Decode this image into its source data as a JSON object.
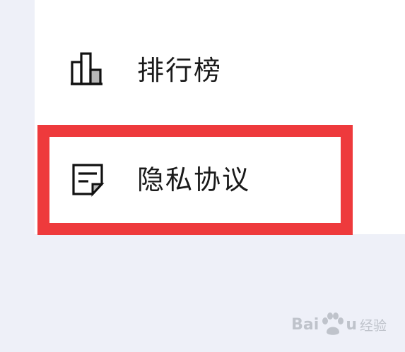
{
  "menu": {
    "items": [
      {
        "label": "排行榜",
        "icon": "bar-chart-icon"
      },
      {
        "label": "隐私协议",
        "icon": "document-note-icon"
      }
    ]
  },
  "highlight": {
    "color": "#ee3a3c",
    "target": "隐私协议"
  },
  "watermark": {
    "brand_left": "Bai",
    "brand_right": "u",
    "subtitle": "经验",
    "icon": "paw-icon"
  }
}
